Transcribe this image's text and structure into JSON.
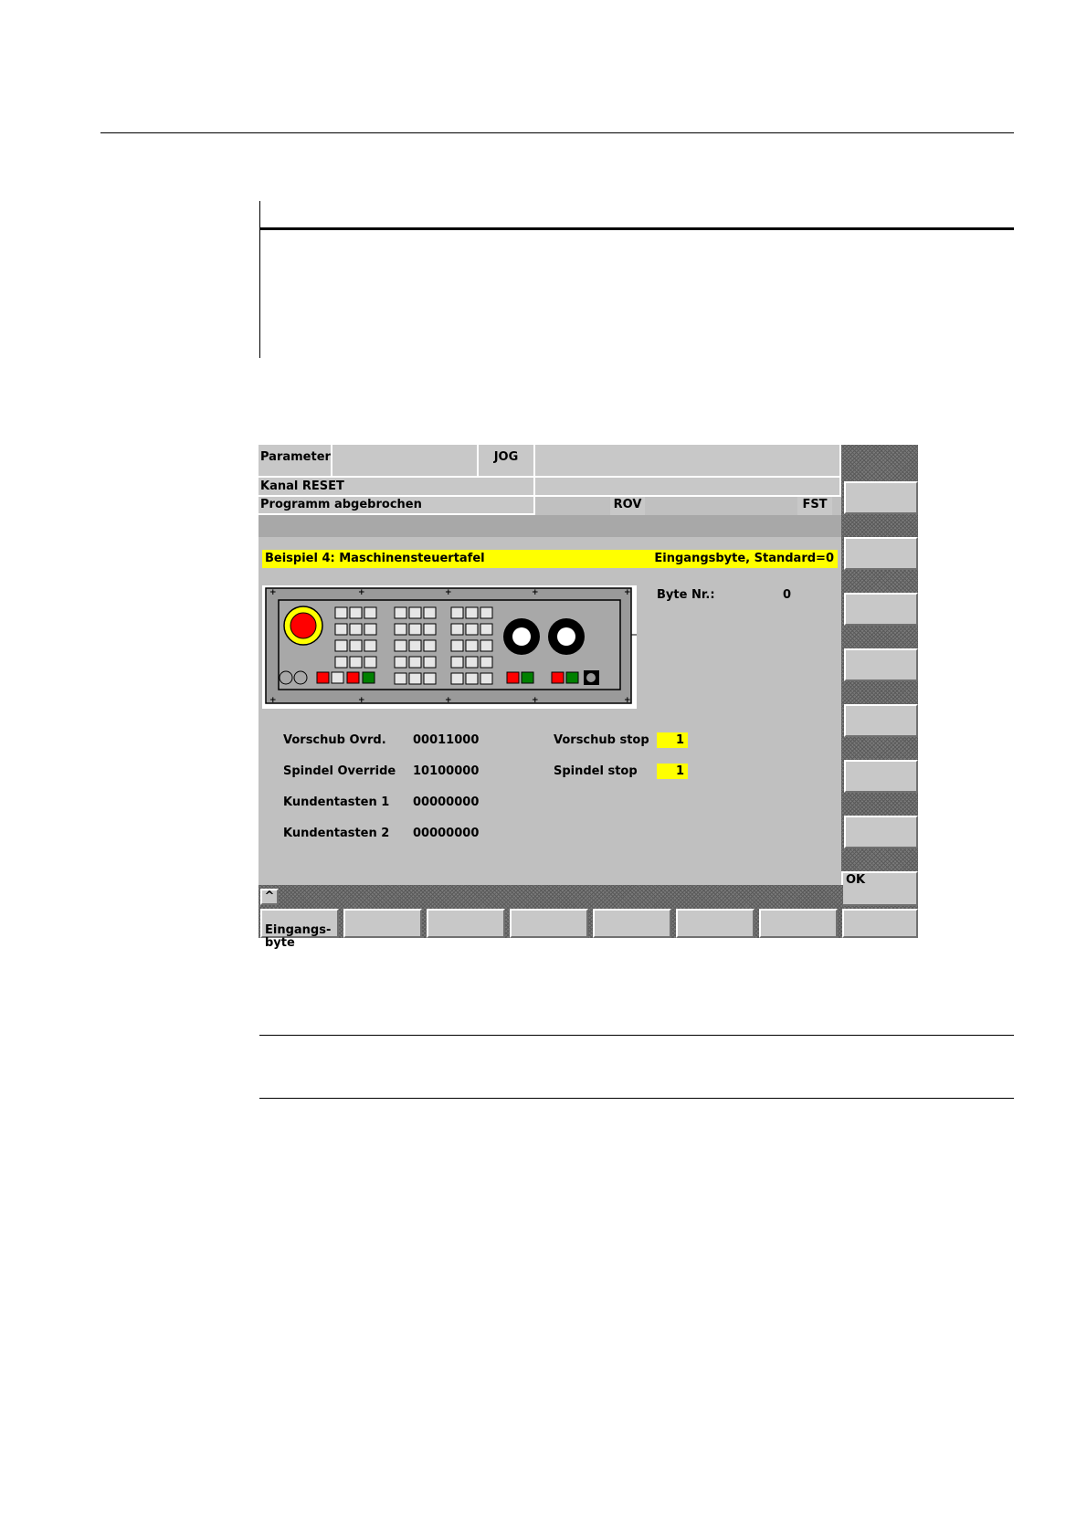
{
  "header": {
    "field_parameter": "Parameter",
    "field_mode": "JOG",
    "channel_status": "Kanal RESET",
    "program_status": "Programm abgebrochen",
    "rov": "ROV",
    "fst": "FST"
  },
  "dialog": {
    "title": "Beispiel 4: Maschinensteuertafel",
    "title_right": "Eingangsbyte, Standard=0",
    "byte_label": "Byte Nr.:",
    "byte_value": "0"
  },
  "params": [
    {
      "label": "Vorschub Ovrd.",
      "value": "00011000"
    },
    {
      "label": "Spindel Override",
      "value": "10100000"
    },
    {
      "label": "Kundentasten 1",
      "value": "00000000"
    },
    {
      "label": "Kundentasten 2",
      "value": "00000000"
    }
  ],
  "stops": [
    {
      "label": "Vorschub stop",
      "value": "1"
    },
    {
      "label": "Spindel stop",
      "value": "1"
    }
  ],
  "right_softkeys": [
    "",
    "",
    "",
    "",
    "",
    "",
    "",
    "OK"
  ],
  "bottom_softkeys": [
    "Eingangs-\nbyte",
    "",
    "",
    "",
    "",
    "",
    "",
    ""
  ],
  "recall_symbol": "^",
  "colors": {
    "highlight": "#ffff00",
    "screen_bg": "#c0c0c0",
    "emergency_stop": "#ff0000",
    "button_red": "#ff0000",
    "button_green": "#008000"
  },
  "icons": [
    "emergency-stop-icon",
    "override-dial-icon"
  ]
}
